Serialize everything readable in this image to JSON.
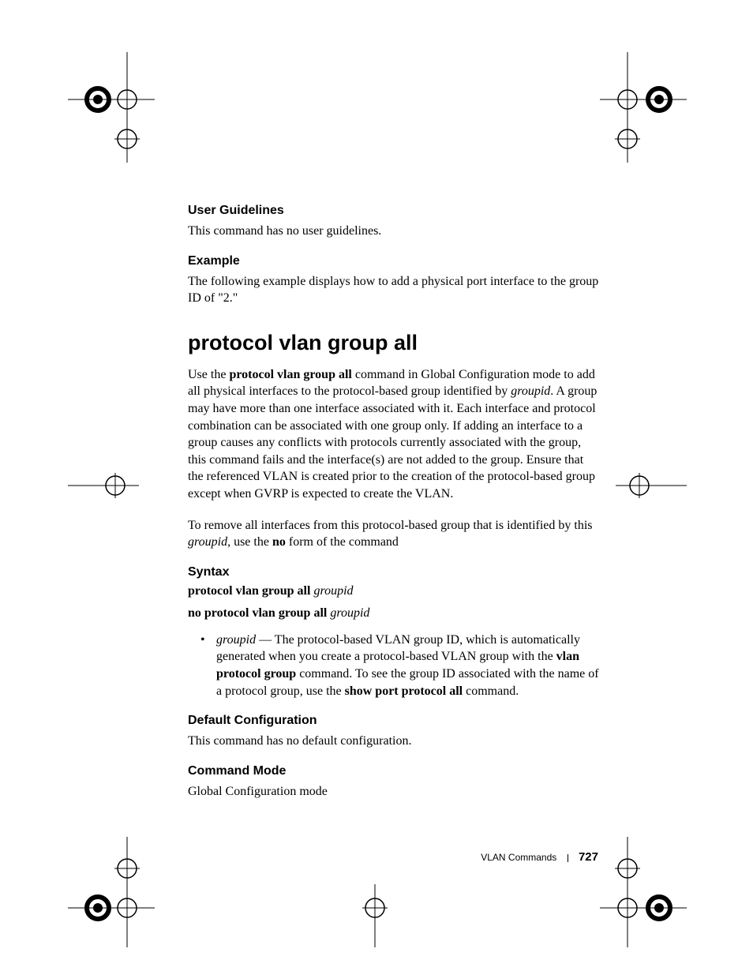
{
  "s1": {
    "title": "User Guidelines",
    "p1": "This command has no user guidelines."
  },
  "s2": {
    "title": "Example",
    "p1": "The following example displays how to add a physical port interface to the group ID of \"2.\""
  },
  "cmd": {
    "title": "protocol vlan group all"
  },
  "desc": {
    "p1a": "Use the ",
    "p1b": "protocol vlan group all",
    "p1c": " command in Global Configuration mode to add all physical interfaces to the protocol-based group identified by ",
    "p1d": "groupid",
    "p1e": ". A group may have more than one interface associated with it. Each interface and protocol combination can be associated with one group only. If adding an interface to a group causes any conflicts with protocols currently associated with the group, this command fails and the interface(s) are not added to the group. Ensure that the referenced VLAN is created prior to the creation of the protocol-based group except when GVRP is expected to create the VLAN.",
    "p2a": "To remove all interfaces from this protocol-based group that is identified by this ",
    "p2b": "groupid",
    "p2c": ", use the ",
    "p2d": "no",
    "p2e": " form of the command"
  },
  "syntax": {
    "title": "Syntax",
    "l1a": "protocol vlan group all ",
    "l1b": "groupid",
    "l2a": "no protocol vlan group all ",
    "l2b": "groupid",
    "b1a": "groupid",
    "b1b": " — The protocol-based VLAN group ID, which is automatically generated when you create a protocol-based VLAN group with the ",
    "b1c": "vlan protocol group",
    "b1d": " command. To see the group ID associated with the name of a protocol group, use the ",
    "b1e": "show port protocol all",
    "b1f": " command."
  },
  "dc": {
    "title": "Default Configuration",
    "p1": "This command has no default configuration."
  },
  "cm": {
    "title": "Command Mode",
    "p1": "Global Configuration mode"
  },
  "footer": {
    "section": "VLAN Commands",
    "page": "727"
  }
}
